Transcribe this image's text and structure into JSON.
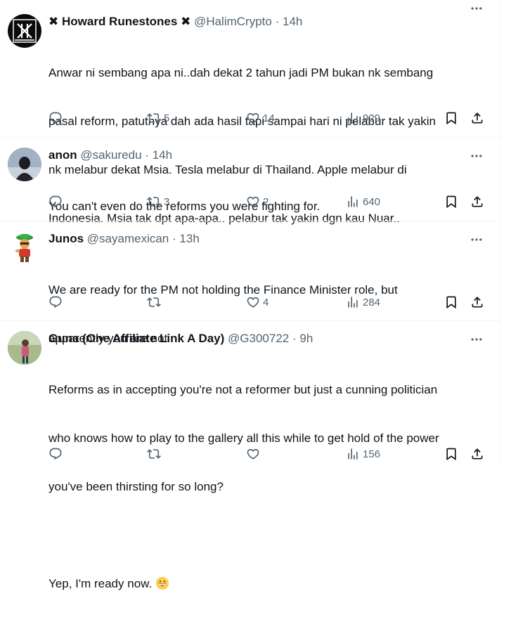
{
  "tweets": [
    {
      "name": "Howard Runestones",
      "name_prefix": "✖",
      "name_suffix": "✖",
      "handle": "@HalimCrypto",
      "time": "14h",
      "text": "Anwar ni sembang apa ni..dah dekat 2 tahun jadi PM bukan nk sembang pasal reform, patutnya dah ada hasil tapi sampai hari ni pelabur tak yakin nk melabur dekat Msia. Tesla melabur di Thailand. Apple melabur di Indonesia. Msia tak dpt apa-apa.. pelabur tak yakin dgn kau Nuar..",
      "lines": [
        "Anwar ni sembang apa ni..dah dekat 2 tahun jadi PM bukan nk sembang",
        "pasal reform, patutnya dah ada hasil tapi sampai hari ni pelabur tak yakin",
        "nk melabur dekat Msia. Tesla melabur di Thailand. Apple melabur di",
        "Indonesia. Msia tak dpt apa-apa.. pelabur tak yakin dgn kau Nuar.."
      ],
      "replies": "",
      "retweets": "5",
      "likes": "14",
      "views": "929"
    },
    {
      "name": "anon",
      "handle": "@sakuredu",
      "time": "14h",
      "lines": [
        "You can't even do the reforms you were fighting for."
      ],
      "replies": "",
      "retweets": "3",
      "likes": "2",
      "views": "640"
    },
    {
      "name": "Junos",
      "handle": "@sayamexican",
      "time": "13h",
      "lines": [
        "We are ready for the PM not holding the Finance Minister role, but",
        "apparently you are not"
      ],
      "replies": "",
      "retweets": "",
      "likes": "4",
      "views": "284"
    },
    {
      "name": "Guna (One Affiliate Link A Day)",
      "handle": "@G300722",
      "time": "9h",
      "lines": [
        "Reforms as in accepting you're not a reformer but just a cunning politician",
        "who knows how to play to the gallery all this while to get hold of the power",
        "you've been thirsting for so long?",
        "",
        "Yep, I'm ready now."
      ],
      "emoji": "grinning-face-emoji",
      "replies": "",
      "retweets": "",
      "likes": "",
      "views": "156"
    }
  ],
  "icons": {
    "reply": "reply-icon",
    "retweet": "retweet-icon",
    "like": "like-icon",
    "views": "views-icon",
    "bookmark": "bookmark-icon",
    "share": "share-icon",
    "more": "more-icon"
  },
  "colors": {
    "text": "#0f1419",
    "muted": "#536471",
    "separator": "#eff3f4"
  }
}
